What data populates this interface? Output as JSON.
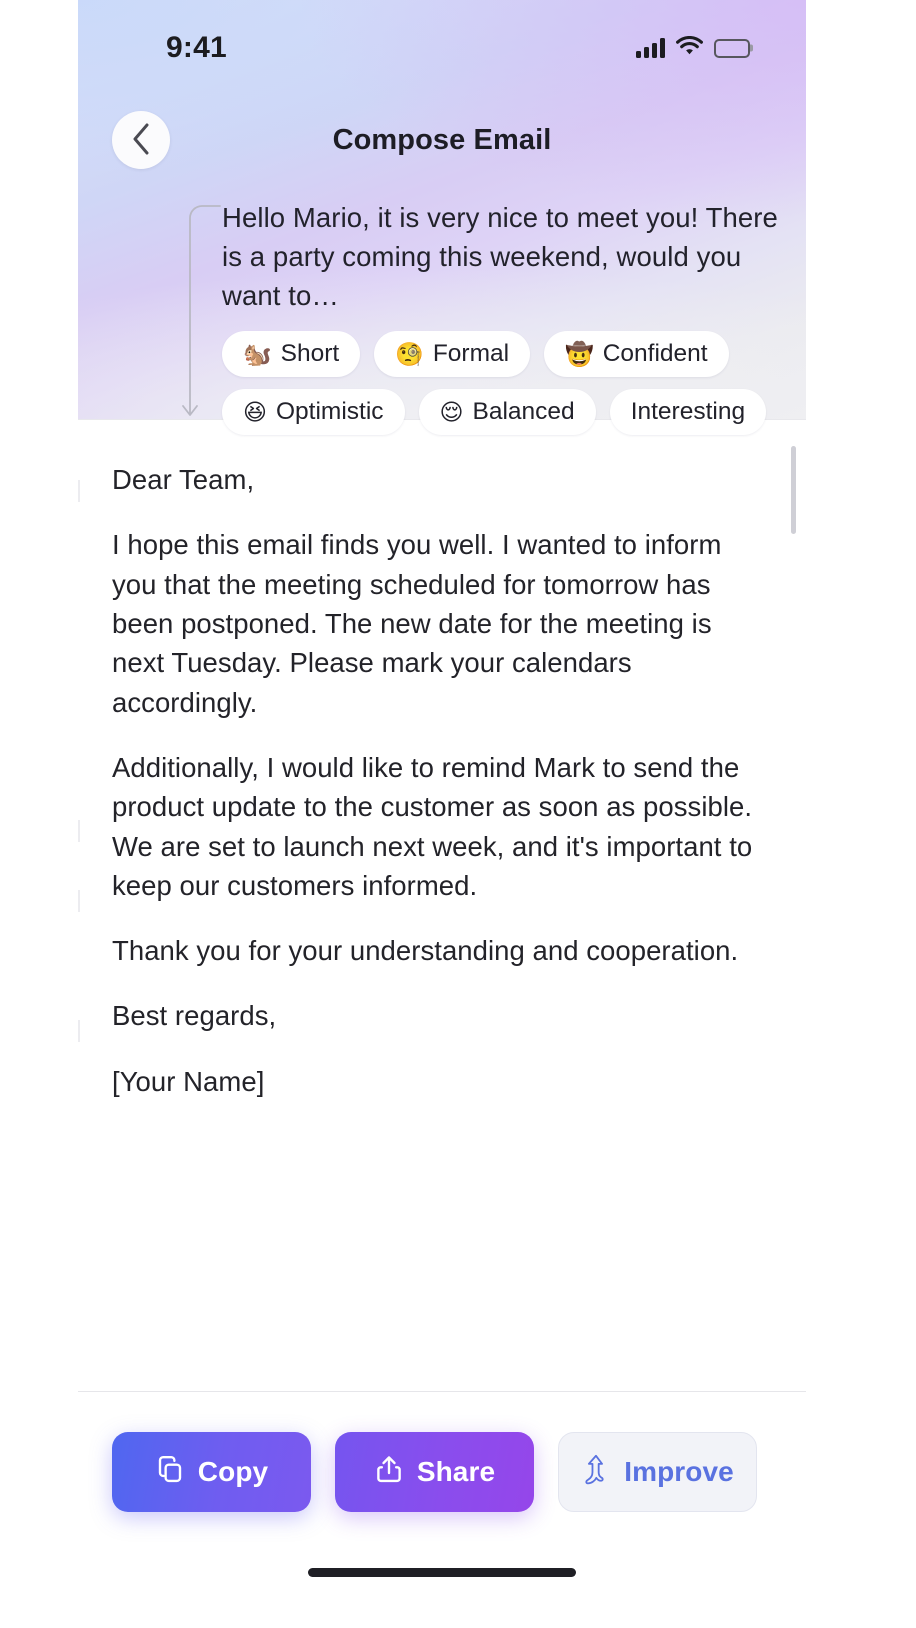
{
  "status_bar": {
    "time": "9:41",
    "cellular_icon": "signal-bars-icon",
    "wifi_icon": "wifi-icon",
    "battery_icon": "battery-full-icon"
  },
  "nav": {
    "back_icon": "chevron-left-icon",
    "title": "Compose Email"
  },
  "prompt": {
    "text": "Hello Mario, it is very nice to meet you! There is a party coming this weekend, would you want to…",
    "connector_icon": "curved-arrow-down-icon",
    "chips": [
      {
        "emoji": "🐿️",
        "label": "Short",
        "emoji_name": "chipmunk-emoji"
      },
      {
        "emoji": "🧐",
        "label": "Formal",
        "emoji_name": "monocle-face-emoji"
      },
      {
        "emoji": "🤠",
        "label": "Confident",
        "emoji_name": "cowboy-hat-face-emoji"
      },
      {
        "emoji": "😆",
        "label": "Optimistic",
        "emoji_name": "grinning-squinting-face-emoji"
      },
      {
        "emoji": "😌",
        "label": "Balanced",
        "emoji_name": "relieved-face-emoji"
      },
      {
        "emoji": "",
        "label": "Interesting",
        "emoji_name": "none"
      }
    ]
  },
  "editor": {
    "paragraphs": [
      "Dear Team,",
      "I hope this email finds you well. I wanted to inform you that the meeting scheduled for tomorrow has been postponed. The new date for the meeting is next Tuesday. Please mark your calendars accordingly.",
      "Additionally, I would like to remind Mark to send the product update to the customer as soon as possible. We are set to launch next week, and it's important to keep our customers informed.",
      "Thank you for your understanding and cooperation.",
      "Best regards,",
      "[Your Name]"
    ]
  },
  "actions": {
    "copy": {
      "label": "Copy",
      "icon": "copy-icon"
    },
    "share": {
      "label": "Share",
      "icon": "share-upload-icon"
    },
    "improve": {
      "label": "Improve",
      "icon": "magic-arrow-up-icon"
    }
  },
  "colors": {
    "copy_gradient_start": "#4f67f0",
    "copy_gradient_end": "#7b59ef",
    "share_gradient_start": "#7555ef",
    "share_gradient_end": "#9546ea",
    "improve_text": "#5a72e0",
    "improve_background": "#f2f3f8",
    "header_gradient_start": "#d6e0f7",
    "header_gradient_end": "#eeeef1",
    "body_text": "#232329"
  }
}
